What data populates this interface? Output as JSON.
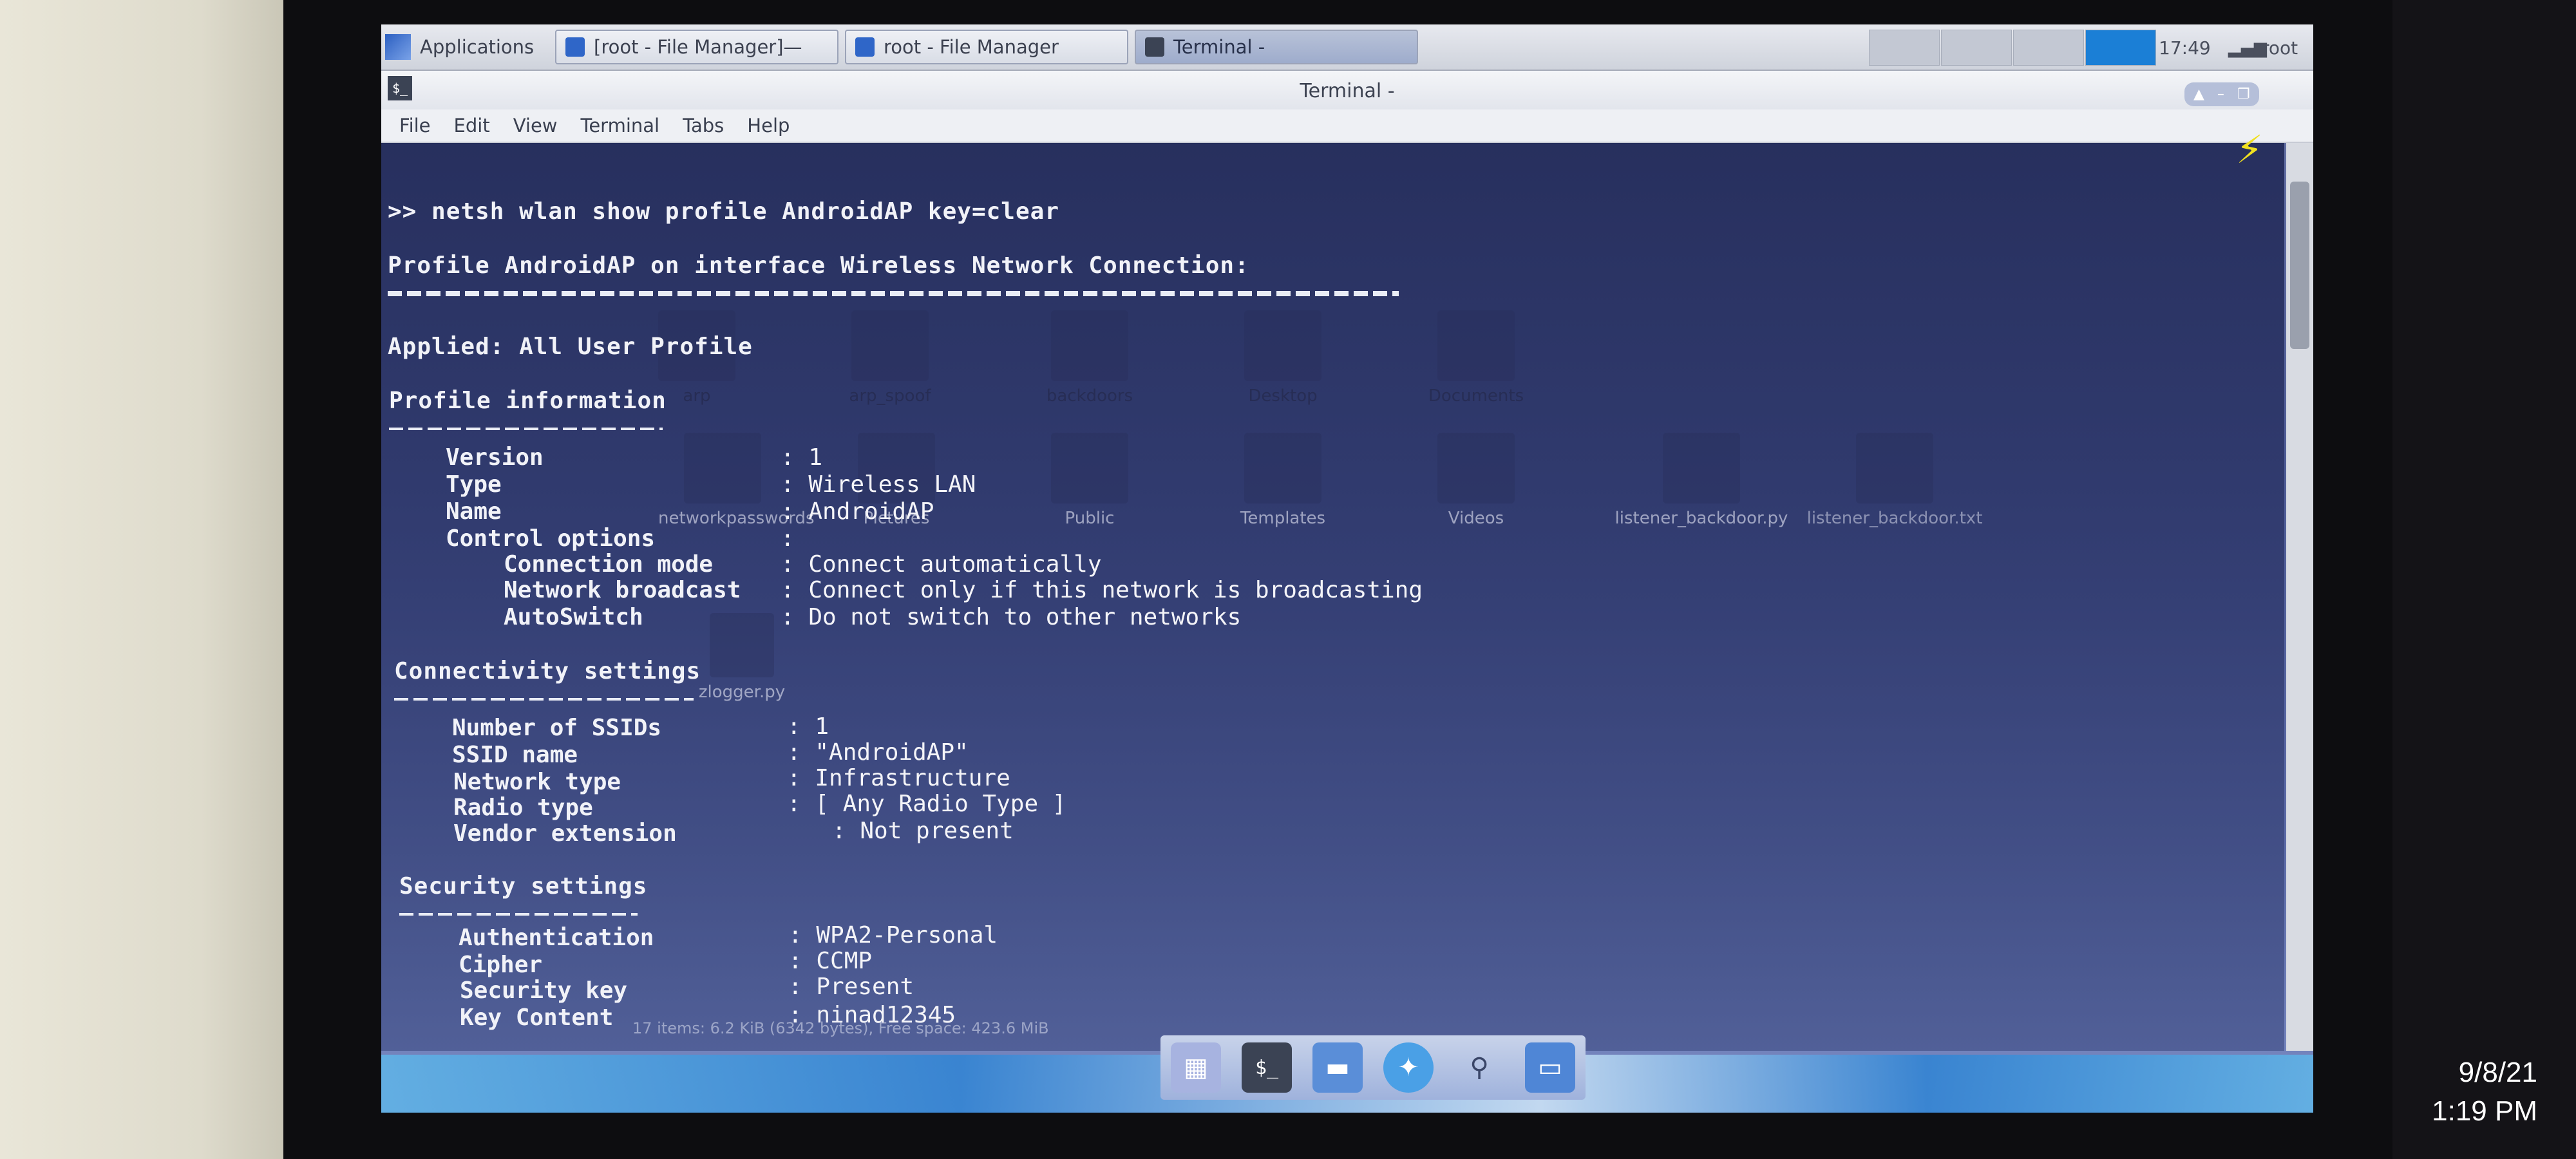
{
  "panel": {
    "applications_label": "Applications",
    "tasks": [
      {
        "label": "[root - File Manager]—"
      },
      {
        "label": "root - File Manager"
      },
      {
        "label": "Terminal -"
      }
    ],
    "clock": "17:49",
    "user": "root"
  },
  "window": {
    "title": "Terminal -",
    "menu": [
      "File",
      "Edit",
      "View",
      "Terminal",
      "Tabs",
      "Help"
    ]
  },
  "terminal": {
    "command": ">> netsh wlan show profile AndroidAP key=clear",
    "profile_header": "Profile AndroidAP on interface Wireless Network Connection:",
    "applied": "Applied: All User Profile",
    "profile_info_title": "Profile information",
    "profile_info": [
      {
        "label": "Version",
        "value": ": 1"
      },
      {
        "label": "Type",
        "value": ": Wireless LAN"
      },
      {
        "label": "Name",
        "value": ": AndroidAP"
      },
      {
        "label": "Control options",
        "value": ":"
      }
    ],
    "control_options": [
      {
        "label": "Connection mode",
        "value": ": Connect automatically"
      },
      {
        "label": "Network broadcast",
        "value": ": Connect only if this network is broadcasting"
      },
      {
        "label": "AutoSwitch",
        "value": ": Do not switch to other networks"
      }
    ],
    "connectivity_title": "Connectivity settings",
    "connectivity": [
      {
        "label": "Number of SSIDs",
        "value": ": 1"
      },
      {
        "label": "SSID name",
        "value": ": \"AndroidAP\""
      },
      {
        "label": "Network type",
        "value": ": Infrastructure"
      },
      {
        "label": "Radio type",
        "value": ": [ Any Radio Type ]"
      },
      {
        "label": "Vendor extension",
        "value": ": Not present"
      }
    ],
    "security_title": "Security settings",
    "security": [
      {
        "label": "Authentication",
        "value": ": WPA2-Personal"
      },
      {
        "label": "Cipher",
        "value": ": CCMP"
      },
      {
        "label": "Security key",
        "value": ": Present"
      },
      {
        "label": "Key Content",
        "value": ": ninad12345"
      }
    ]
  },
  "file_manager_ghost": {
    "items_row1": [
      "arp",
      "arp_spoof",
      "backdoors",
      "Desktop",
      "Documents"
    ],
    "items_row2": [
      "networkpasswords",
      "Pictures",
      "Public",
      "Templates",
      "Videos",
      "listener_backdoor.py",
      "listener_backdoor.txt"
    ],
    "item_row3": "zlogger.py",
    "status": "17 items: 6.2 KiB (6342 bytes), Free space: 423.6 MiB"
  },
  "photo": {
    "date": "9/8/21",
    "time": "1:19 PM"
  },
  "colors": {
    "panel_bg": "#d9dde6",
    "terminal_bg": "#2e386c",
    "terminal_fg": "#f1f2f8",
    "dock_accent": "#2f84d4"
  }
}
